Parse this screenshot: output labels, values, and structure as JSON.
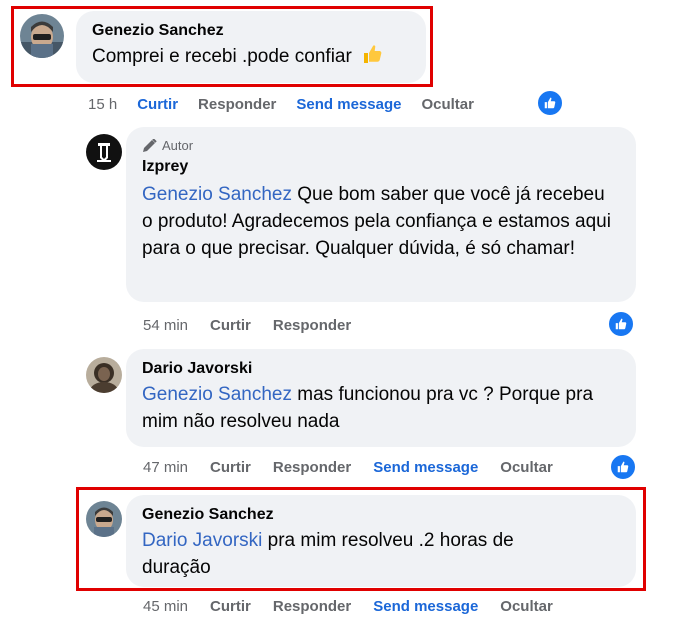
{
  "comments": [
    {
      "author": "Genezio Sanchez",
      "text": "Comprei e recebi .pode confiar",
      "time": "15 h",
      "actions": [
        "Curtir",
        "Responder",
        "Send message",
        "Ocultar"
      ],
      "reaction": "like",
      "emoji": "thumbs-up"
    },
    {
      "author_tag": "Autor",
      "author": "Izprey",
      "mention": "Genezio Sanchez",
      "text": "Que bom saber que você já recebeu o produto! Agradecemos pela confiança e estamos aqui para o que precisar. Qualquer dúvida, é só chamar!",
      "time": "54 min",
      "actions": [
        "Curtir",
        "Responder"
      ],
      "reaction": "like"
    },
    {
      "author": "Dario Javorski",
      "mention": "Genezio Sanchez",
      "text": "mas funcionou pra vc ? Porque pra mim não resolveu nada",
      "time": "47 min",
      "actions": [
        "Curtir",
        "Responder",
        "Send message",
        "Ocultar"
      ],
      "reaction": "like"
    },
    {
      "author": "Genezio Sanchez",
      "mention": "Dario Javorski",
      "text": "pra mim resolveu .2 horas de duração",
      "time": "45 min",
      "actions": [
        "Curtir",
        "Responder",
        "Send message",
        "Ocultar"
      ]
    }
  ],
  "colors": {
    "highlight": "#e00000",
    "mention": "#3366c2",
    "action_blue": "#1b67d8",
    "like": "#1877f2",
    "bubble": "#f0f2f5"
  }
}
